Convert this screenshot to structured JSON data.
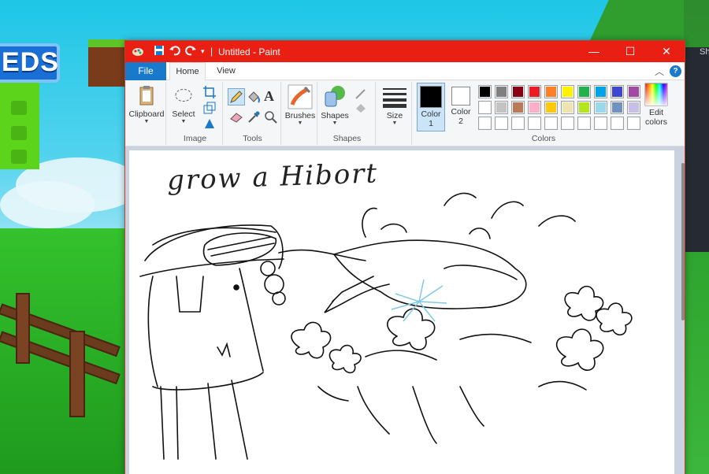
{
  "background": {
    "sign_text": "EDS",
    "side_text": "Sh"
  },
  "window": {
    "title": "Untitled - Paint",
    "buttons": {
      "minimize": "—",
      "maximize": "☐",
      "close": "✕"
    },
    "tabs": {
      "file": "File",
      "home": "Home",
      "view": "View"
    },
    "help": "?"
  },
  "ribbon": {
    "clipboard": {
      "button": "Clipboard",
      "group": ""
    },
    "image": {
      "select": "Select",
      "group": "Image"
    },
    "tools": {
      "group": "Tools"
    },
    "brushes": {
      "button": "Brushes"
    },
    "shapes": {
      "button": "Shapes",
      "group": "Shapes"
    },
    "size": {
      "button": "Size"
    },
    "color1": {
      "line1": "Color",
      "line2": "1",
      "value": "#000000"
    },
    "color2": {
      "line1": "Color",
      "line2": "2",
      "value": "#ffffff"
    },
    "colors": {
      "group": "Colors",
      "row1": [
        "#000000",
        "#7f7f7f",
        "#880015",
        "#ed1c24",
        "#ff7f27",
        "#fff200",
        "#22b14c",
        "#00a2e8",
        "#3f48cc",
        "#a349a4"
      ],
      "row2": [
        "#ffffff",
        "#c3c3c3",
        "#b97a57",
        "#ffaec9",
        "#ffc90e",
        "#efe4b0",
        "#b5e61d",
        "#99d9ea",
        "#7092be",
        "#c8bfe7"
      ]
    },
    "edit_colors": {
      "line1": "Edit",
      "line2": "colors"
    }
  },
  "drawing": {
    "text": "grow a Hibort"
  }
}
